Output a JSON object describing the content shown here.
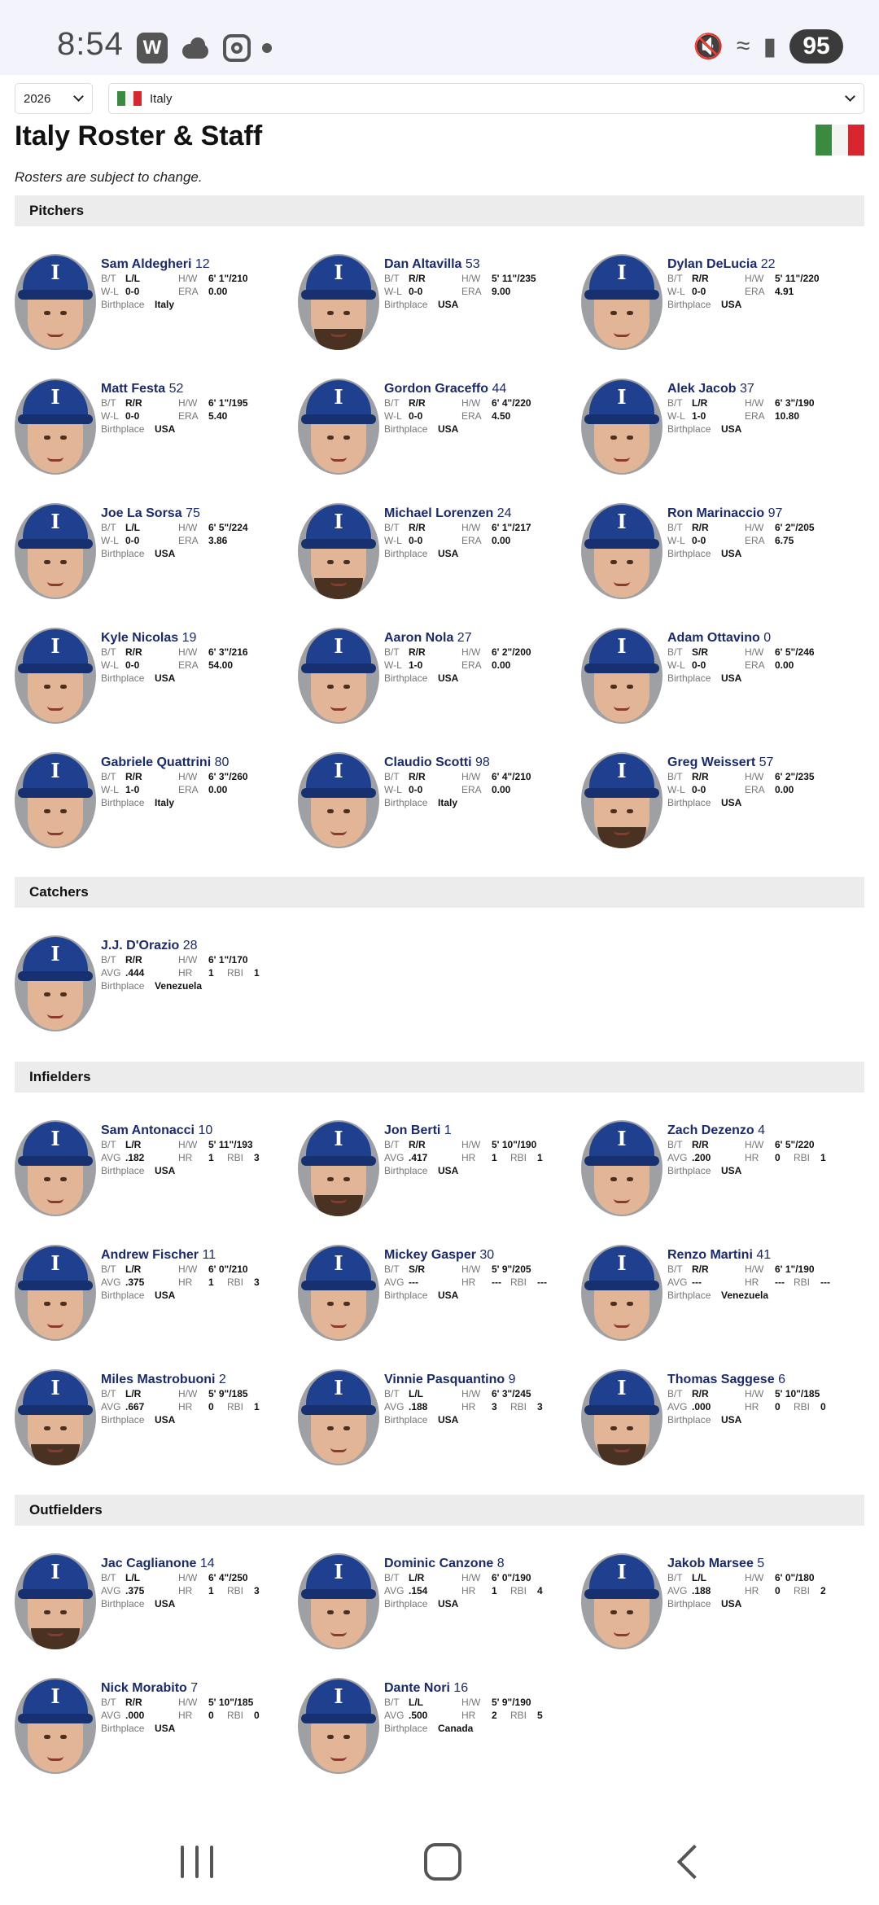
{
  "status": {
    "time": "8:54",
    "battery": "95",
    "w_badge": "W"
  },
  "year_select": "2026",
  "country_select": "Italy",
  "title": "Italy Roster & Staff",
  "subtitle": "Rosters are subject to change.",
  "sections": {
    "pitchers": "Pitchers",
    "catchers": "Catchers",
    "infielders": "Infielders",
    "outfielders": "Outfielders"
  },
  "labels": {
    "bt": "B/T",
    "hw": "H/W",
    "wl": "W-L",
    "era": "ERA",
    "avg": "AVG",
    "hr": "HR",
    "rbi": "RBI",
    "birth": "Birthplace"
  },
  "pitchers": [
    {
      "name": "Sam Aldegheri",
      "num": "12",
      "bt": "L/L",
      "hw": "6' 1\"/210",
      "wl": "0-0",
      "era": "0.00",
      "birth": "Italy"
    },
    {
      "name": "Dan Altavilla",
      "num": "53",
      "bt": "R/R",
      "hw": "5' 11\"/235",
      "wl": "0-0",
      "era": "9.00",
      "birth": "USA"
    },
    {
      "name": "Dylan DeLucia",
      "num": "22",
      "bt": "R/R",
      "hw": "5' 11\"/220",
      "wl": "0-0",
      "era": "4.91",
      "birth": "USA"
    },
    {
      "name": "Matt Festa",
      "num": "52",
      "bt": "R/R",
      "hw": "6' 1\"/195",
      "wl": "0-0",
      "era": "5.40",
      "birth": "USA"
    },
    {
      "name": "Gordon Graceffo",
      "num": "44",
      "bt": "R/R",
      "hw": "6' 4\"/220",
      "wl": "0-0",
      "era": "4.50",
      "birth": "USA"
    },
    {
      "name": "Alek Jacob",
      "num": "37",
      "bt": "L/R",
      "hw": "6' 3\"/190",
      "wl": "1-0",
      "era": "10.80",
      "birth": "USA"
    },
    {
      "name": "Joe La Sorsa",
      "num": "75",
      "bt": "L/L",
      "hw": "6' 5\"/224",
      "wl": "0-0",
      "era": "3.86",
      "birth": "USA"
    },
    {
      "name": "Michael Lorenzen",
      "num": "24",
      "bt": "R/R",
      "hw": "6' 1\"/217",
      "wl": "0-0",
      "era": "0.00",
      "birth": "USA"
    },
    {
      "name": "Ron Marinaccio",
      "num": "97",
      "bt": "R/R",
      "hw": "6' 2\"/205",
      "wl": "0-0",
      "era": "6.75",
      "birth": "USA"
    },
    {
      "name": "Kyle Nicolas",
      "num": "19",
      "bt": "R/R",
      "hw": "6' 3\"/216",
      "wl": "0-0",
      "era": "54.00",
      "birth": "USA"
    },
    {
      "name": "Aaron Nola",
      "num": "27",
      "bt": "R/R",
      "hw": "6' 2\"/200",
      "wl": "1-0",
      "era": "0.00",
      "birth": "USA"
    },
    {
      "name": "Adam Ottavino",
      "num": "0",
      "bt": "S/R",
      "hw": "6' 5\"/246",
      "wl": "0-0",
      "era": "0.00",
      "birth": "USA"
    },
    {
      "name": "Gabriele Quattrini",
      "num": "80",
      "bt": "R/R",
      "hw": "6' 3\"/260",
      "wl": "1-0",
      "era": "0.00",
      "birth": "Italy"
    },
    {
      "name": "Claudio Scotti",
      "num": "98",
      "bt": "R/R",
      "hw": "6' 4\"/210",
      "wl": "0-0",
      "era": "0.00",
      "birth": "Italy"
    },
    {
      "name": "Greg Weissert",
      "num": "57",
      "bt": "R/R",
      "hw": "6' 2\"/235",
      "wl": "0-0",
      "era": "0.00",
      "birth": "USA"
    }
  ],
  "catchers": [
    {
      "name": "J.J. D'Orazio",
      "num": "28",
      "bt": "R/R",
      "hw": "6' 1\"/170",
      "avg": ".444",
      "hr": "1",
      "rbi": "1",
      "birth": "Venezuela"
    }
  ],
  "infielders": [
    {
      "name": "Sam Antonacci",
      "num": "10",
      "bt": "L/R",
      "hw": "5' 11\"/193",
      "avg": ".182",
      "hr": "1",
      "rbi": "3",
      "birth": "USA"
    },
    {
      "name": "Jon Berti",
      "num": "1",
      "bt": "R/R",
      "hw": "5' 10\"/190",
      "avg": ".417",
      "hr": "1",
      "rbi": "1",
      "birth": "USA"
    },
    {
      "name": "Zach Dezenzo",
      "num": "4",
      "bt": "R/R",
      "hw": "6' 5\"/220",
      "avg": ".200",
      "hr": "0",
      "rbi": "1",
      "birth": "USA"
    },
    {
      "name": "Andrew Fischer",
      "num": "11",
      "bt": "L/R",
      "hw": "6' 0\"/210",
      "avg": ".375",
      "hr": "1",
      "rbi": "3",
      "birth": "USA"
    },
    {
      "name": "Mickey Gasper",
      "num": "30",
      "bt": "S/R",
      "hw": "5' 9\"/205",
      "avg": "---",
      "hr": "---",
      "rbi": "---",
      "birth": "USA"
    },
    {
      "name": "Renzo Martini",
      "num": "41",
      "bt": "R/R",
      "hw": "6' 1\"/190",
      "avg": "---",
      "hr": "---",
      "rbi": "---",
      "birth": "Venezuela"
    },
    {
      "name": "Miles Mastrobuoni",
      "num": "2",
      "bt": "L/R",
      "hw": "5' 9\"/185",
      "avg": ".667",
      "hr": "0",
      "rbi": "1",
      "birth": "USA"
    },
    {
      "name": "Vinnie Pasquantino",
      "num": "9",
      "bt": "L/L",
      "hw": "6' 3\"/245",
      "avg": ".188",
      "hr": "3",
      "rbi": "3",
      "birth": "USA"
    },
    {
      "name": "Thomas Saggese",
      "num": "6",
      "bt": "R/R",
      "hw": "5' 10\"/185",
      "avg": ".000",
      "hr": "0",
      "rbi": "0",
      "birth": "USA"
    }
  ],
  "outfielders": [
    {
      "name": "Jac Caglianone",
      "num": "14",
      "bt": "L/L",
      "hw": "6' 4\"/250",
      "avg": ".375",
      "hr": "1",
      "rbi": "3",
      "birth": "USA"
    },
    {
      "name": "Dominic Canzone",
      "num": "8",
      "bt": "L/R",
      "hw": "6' 0\"/190",
      "avg": ".154",
      "hr": "1",
      "rbi": "4",
      "birth": "USA"
    },
    {
      "name": "Jakob Marsee",
      "num": "5",
      "bt": "L/L",
      "hw": "6' 0\"/180",
      "avg": ".188",
      "hr": "0",
      "rbi": "2",
      "birth": "USA"
    },
    {
      "name": "Nick Morabito",
      "num": "7",
      "bt": "R/R",
      "hw": "5' 10\"/185",
      "avg": ".000",
      "hr": "0",
      "rbi": "0",
      "birth": "USA"
    },
    {
      "name": "Dante Nori",
      "num": "16",
      "bt": "L/L",
      "hw": "5' 9\"/190",
      "avg": ".500",
      "hr": "2",
      "rbi": "5",
      "birth": "Canada"
    }
  ],
  "cap_logo": "I",
  "colors": {
    "name": "#1a2a6c",
    "cap": "#1f3f8f",
    "section_bg": "#ececec"
  }
}
